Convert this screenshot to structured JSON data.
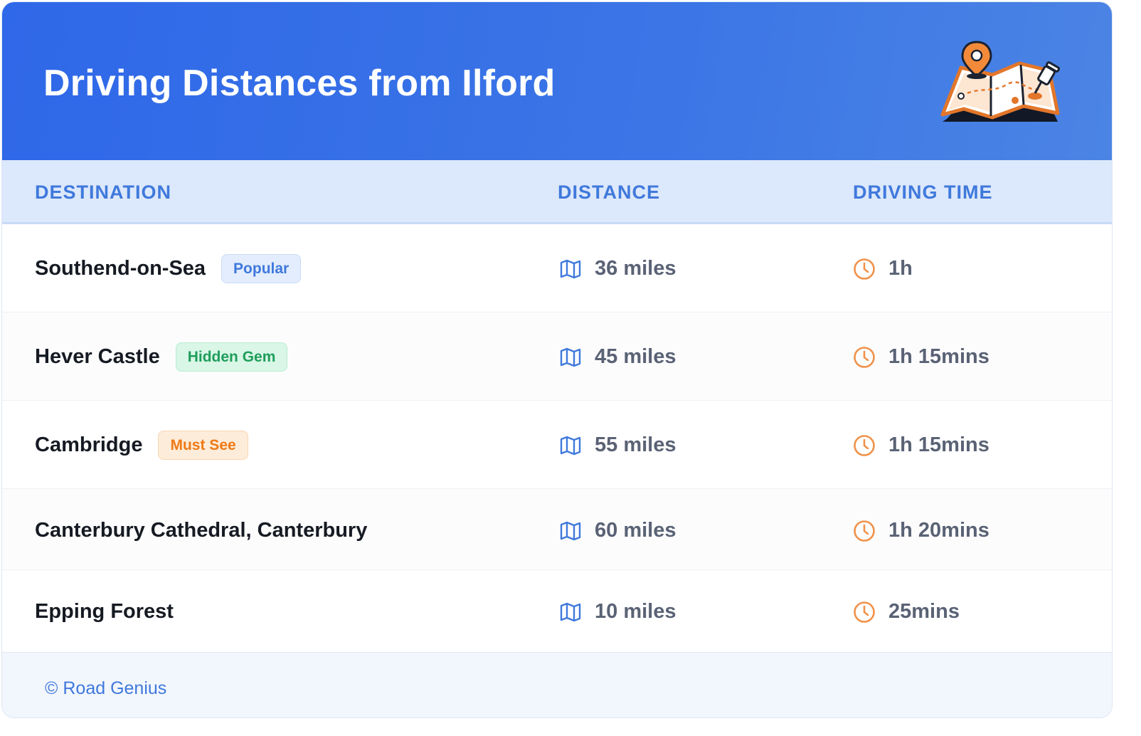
{
  "header": {
    "title": "Driving Distances from Ilford",
    "illustration": "map-with-pins-icon"
  },
  "table": {
    "columns": [
      "DESTINATION",
      "DISTANCE",
      "DRIVING TIME"
    ],
    "rows": [
      {
        "destination": "Southend-on-Sea",
        "badge": "Popular",
        "distance": "36 miles",
        "time": "1h"
      },
      {
        "destination": "Hever Castle",
        "badge": "Hidden Gem",
        "distance": "45 miles",
        "time": "1h 15mins"
      },
      {
        "destination": "Cambridge",
        "badge": "Must See",
        "distance": "55 miles",
        "time": "1h 15mins"
      },
      {
        "destination": "Canterbury Cathedral, Canterbury",
        "badge": "",
        "distance": "60 miles",
        "time": "1h 20mins"
      },
      {
        "destination": "Epping Forest",
        "badge": "",
        "distance": "10 miles",
        "time": "25mins"
      }
    ],
    "icons": {
      "distance": "map-icon",
      "time": "clock-icon"
    }
  },
  "footer": {
    "credit": "© Road Genius"
  },
  "colors": {
    "header_bg": "#2f68e8",
    "accent": "#3f79dc",
    "popular": "#3f79dc",
    "hidden_gem": "#1f9e5b",
    "must_see": "#ee7a16",
    "clock": "#f0924a"
  }
}
